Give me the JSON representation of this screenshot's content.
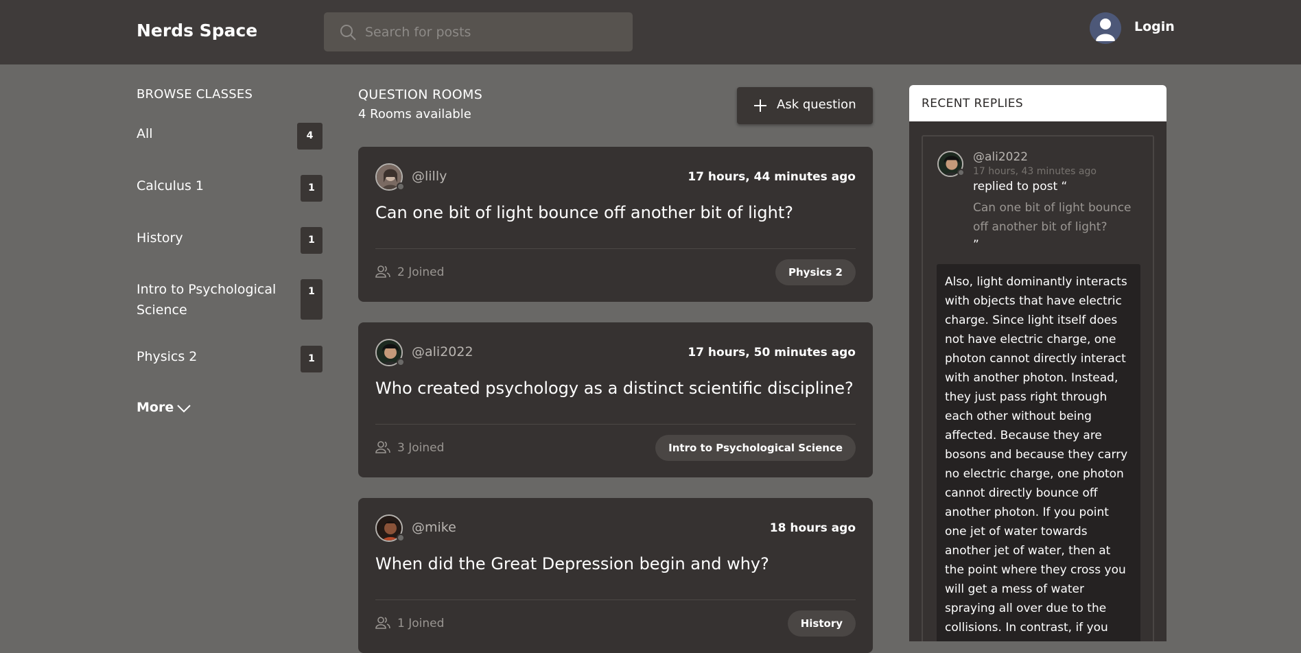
{
  "header": {
    "logo": "Nerds Space",
    "search_placeholder": "Search for posts",
    "login_label": "Login"
  },
  "sidebar": {
    "title": "BROWSE CLASSES",
    "items": [
      {
        "label": "All",
        "count": "4"
      },
      {
        "label": "Calculus 1",
        "count": "1"
      },
      {
        "label": "History",
        "count": "1"
      },
      {
        "label": "Intro to Psychological Science",
        "count": "1"
      },
      {
        "label": "Physics 2",
        "count": "1"
      }
    ],
    "more_label": "More"
  },
  "main": {
    "title": "QUESTION ROOMS",
    "subtitle": "4 Rooms available",
    "ask_label": "Ask question",
    "rooms": [
      {
        "user": "@lilly",
        "time": "17 hours, 44 minutes ago",
        "question": "Can one bit of light bounce off another bit of light?",
        "joined": "2 Joined",
        "tag": "Physics 2"
      },
      {
        "user": "@ali2022",
        "time": "17 hours, 50 minutes ago",
        "question": "Who created psychology as a distinct scientific discipline?",
        "joined": "3 Joined",
        "tag": "Intro to Psychological Science"
      },
      {
        "user": "@mike",
        "time": "18 hours ago",
        "question": "When did the Great Depression begin and why?",
        "joined": "1 Joined",
        "tag": "History"
      }
    ]
  },
  "replies": {
    "title": "RECENT REPLIES",
    "items": [
      {
        "user": "@ali2022",
        "time": "17 hours, 43 minutes ago",
        "replied_to": "replied to post “",
        "post": "Can one bit of light bounce off another bit of light?",
        "close_quote": "”",
        "body": "Also, light dominantly interacts with objects that have electric charge. Since light itself does not have electric charge, one photon cannot directly interact with another photon. Instead, they just pass right through each other without being affected. Because they are bosons and because they carry no electric charge, one photon cannot directly bounce off another photon. If you point one jet of water towards another jet of water, then at the point where they cross you will get a mess of water spraying all over due to the collisions. In contrast, if you shine one light beam such that it"
      }
    ]
  },
  "colors": {
    "page_bg": "#696866",
    "header_bg": "#3f3b3a",
    "card_bg": "#363231",
    "tag_bg": "#4a4644"
  },
  "icons": [
    "search-icon",
    "user-avatar-icon",
    "chevron-down-icon",
    "plus-icon",
    "people-icon"
  ]
}
